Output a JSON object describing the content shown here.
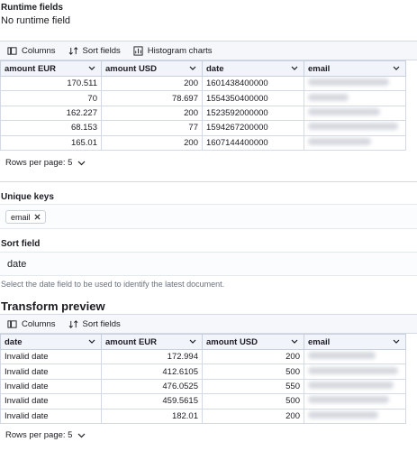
{
  "runtime": {
    "label": "Runtime fields",
    "value": "No runtime field"
  },
  "source_toolbar": {
    "columns": "Columns",
    "sort_fields": "Sort fields",
    "histogram": "Histogram charts"
  },
  "source_table": {
    "headers": [
      "amount EUR",
      "amount USD",
      "date",
      "email"
    ],
    "rows": [
      [
        "170.511",
        "200",
        "1601438400000",
        ""
      ],
      [
        "70",
        "78.697",
        "1554350400000",
        ""
      ],
      [
        "162.227",
        "200",
        "1523592000000",
        ""
      ],
      [
        "68.153",
        "77",
        "1594267200000",
        ""
      ],
      [
        "165.01",
        "200",
        "1607144400000",
        ""
      ]
    ]
  },
  "source_rows_per_page": "Rows per page: 5",
  "unique_keys": {
    "label": "Unique keys",
    "chip": "email"
  },
  "sort_field": {
    "label": "Sort field",
    "value": "date",
    "help": "Select the date field to be used to identify the latest document."
  },
  "preview": {
    "title": "Transform preview",
    "toolbar": {
      "columns": "Columns",
      "sort_fields": "Sort fields"
    },
    "headers": [
      "date",
      "amount EUR",
      "amount USD",
      "email"
    ],
    "rows": [
      [
        "Invalid date",
        "172.994",
        "200",
        ""
      ],
      [
        "Invalid date",
        "412.6105",
        "500",
        ""
      ],
      [
        "Invalid date",
        "476.0525",
        "550",
        ""
      ],
      [
        "Invalid date",
        "459.5615",
        "500",
        ""
      ],
      [
        "Invalid date",
        "182.01",
        "200",
        ""
      ]
    ],
    "rows_per_page": "Rows per page: 5"
  },
  "colors": {
    "border": "#d3dae6",
    "header_bg": "#f1f4fa",
    "text": "#1a1c21",
    "muted": "#69707d"
  }
}
